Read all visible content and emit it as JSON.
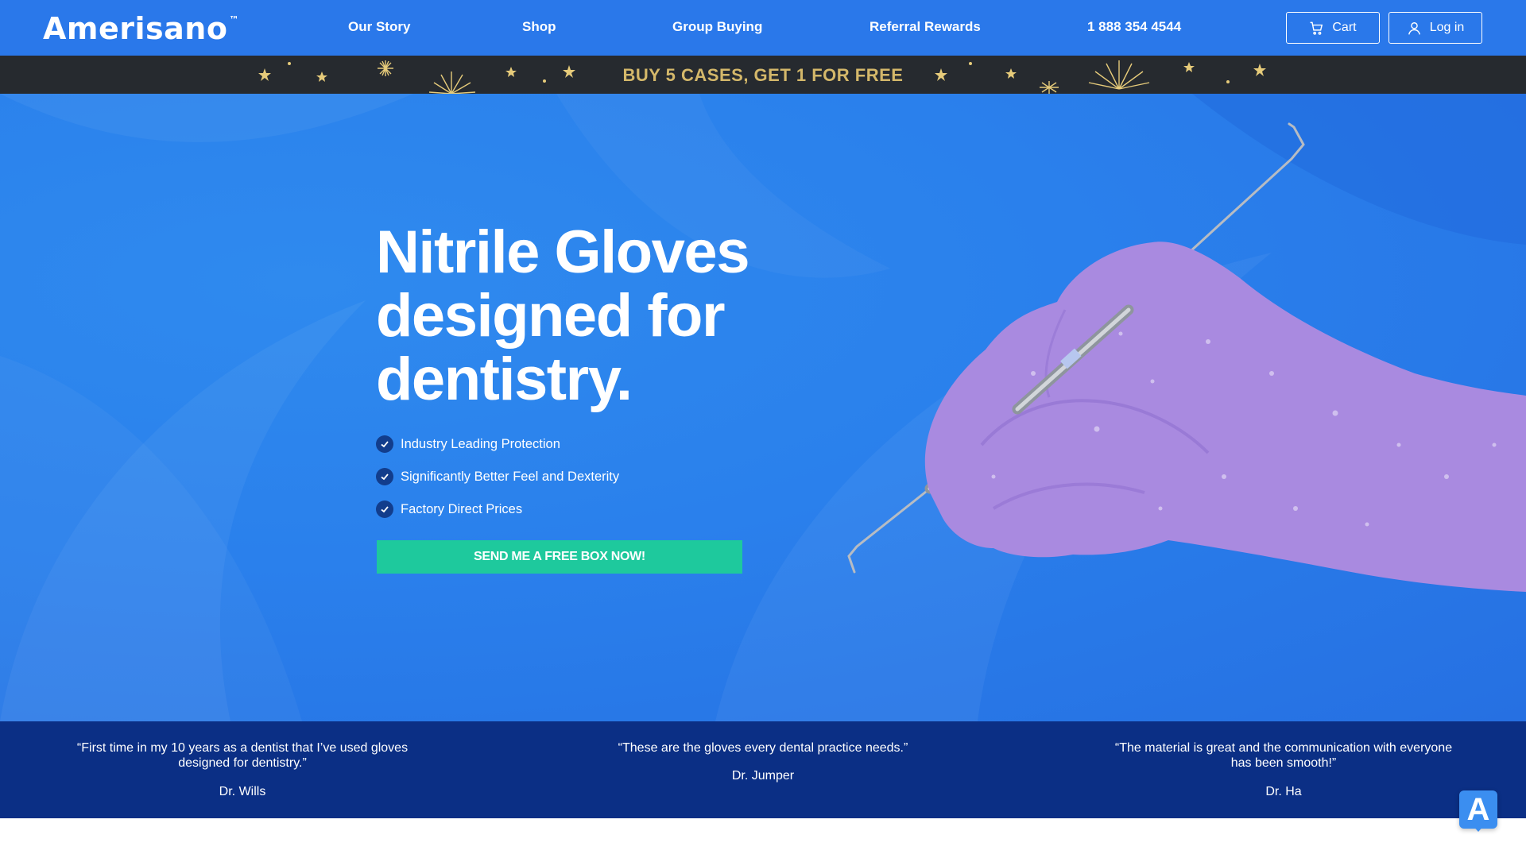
{
  "nav": {
    "logo": "Amerisano",
    "logo_tm": "™",
    "links": [
      "Our Story",
      "Shop",
      "Group Buying",
      "Referral Rewards",
      "1 888 354 4544"
    ],
    "cart_label": "Cart",
    "login_label": "Log in"
  },
  "promo": {
    "text": "BUY 5 CASES, GET 1 FOR FREE"
  },
  "hero": {
    "headline": [
      "Nitrile Gloves",
      "designed for",
      "dentistry."
    ],
    "features": [
      "Industry Leading Protection",
      "Significantly Better Feel and Dexterity",
      "Factory Direct Prices"
    ],
    "cta_label": "SEND ME A FREE BOX NOW!"
  },
  "testimonials": [
    {
      "quote": "“First time in my 10 years as a dentist that I’ve used gloves designed for dentistry.”",
      "author": "Dr. Wills"
    },
    {
      "quote": "“These are the gloves every dental practice needs.”",
      "author": "Dr. Jumper"
    },
    {
      "quote": "“The material is great and the communication with everyone has been smooth!”",
      "author": "Dr. Ha"
    }
  ],
  "widget": {
    "letter": "A"
  },
  "colors": {
    "nav": "#2a78ea",
    "promo_bg": "#262a2f",
    "promo_text": "#d4b86a",
    "cta": "#1ec99d",
    "testimonial_bg": "#0b2f85",
    "glove": "#a98ae0"
  }
}
